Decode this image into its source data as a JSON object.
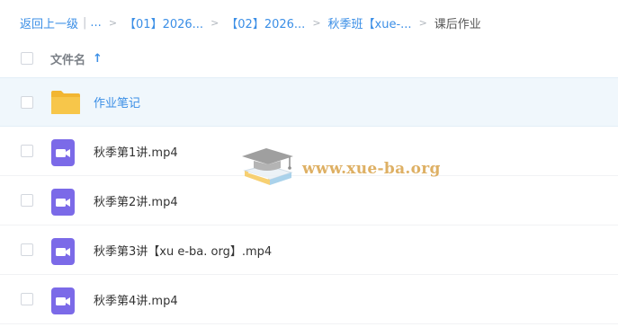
{
  "breadcrumb": {
    "back_label": "返回上一级",
    "divider": "|",
    "ellipsis": "...",
    "items": [
      {
        "label": "【01】2026..."
      },
      {
        "label": "【02】2026..."
      },
      {
        "label": "秋季班【xue-..."
      }
    ],
    "current": "课后作业",
    "separator": ">"
  },
  "header": {
    "column_label": "文件名",
    "sort_icon": "arrow-up-icon",
    "sort_glyph": "↑"
  },
  "files": [
    {
      "name": "作业笔记",
      "type": "folder",
      "icon": "folder-icon"
    },
    {
      "name": "秋季第1讲.mp4",
      "type": "video",
      "icon": "video-file-icon"
    },
    {
      "name": "秋季第2讲.mp4",
      "type": "video",
      "icon": "video-file-icon"
    },
    {
      "name": "秋季第3讲【xu e-ba. org】.mp4",
      "type": "video",
      "icon": "video-file-icon"
    },
    {
      "name": "秋季第4讲.mp4",
      "type": "video",
      "icon": "video-file-icon"
    }
  ],
  "watermark": {
    "text": "www.xue-ba.org",
    "icon": "graduation-cap-book-icon"
  },
  "colors": {
    "link": "#3a8ee6",
    "folder": "#f7c64a",
    "video": "#7b6ae8",
    "selected_row": "#f0f7fc",
    "watermark": "#d9a34a"
  }
}
